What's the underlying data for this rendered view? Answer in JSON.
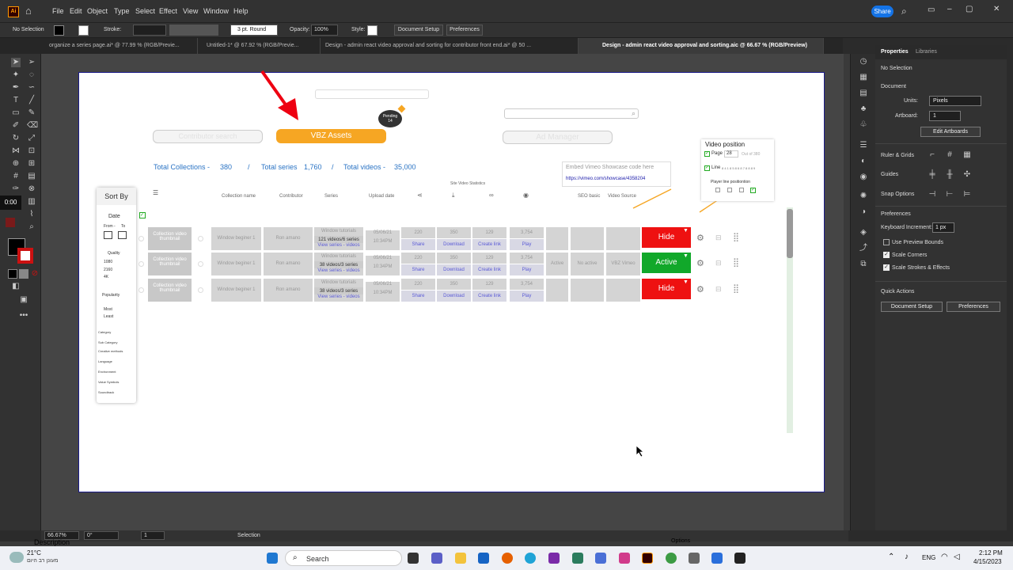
{
  "menubar": {
    "logo": "Ai",
    "items": [
      "File",
      "Edit",
      "Object",
      "Type",
      "Select",
      "Effect",
      "View",
      "Window",
      "Help"
    ],
    "share": "Share"
  },
  "control": {
    "selection": "No Selection",
    "stroke": "Stroke:",
    "brush": "3 pt. Round",
    "opacity_label": "Opacity:",
    "opacity": "100%",
    "style": "Style:",
    "doc_setup": "Document Setup",
    "preferences": "Preferences"
  },
  "tabs": [
    "organize a series page.ai* @ 77.99 % (RGB/Previe...",
    "Untitled-1* @ 67.92 % (RGB/Previe...",
    "Design - admin react video approval and sorting for contributor front end.ai* @ 50 ...",
    "Design - admin react video approval and sorting.aic @ 66.67 % (RGB/Preview)"
  ],
  "timer": "0:00",
  "design": {
    "top_buttons": [
      "Contributor search",
      "VBZ Assets",
      "Ad Manager"
    ],
    "pending_label": "Pending",
    "pending_count": "14",
    "totals": {
      "collections_label": "Total Collections -",
      "collections": "380",
      "series_label": "Total series",
      "series": "1,760",
      "videos_label": "Total videos -",
      "videos": "35,000",
      "sep": "/"
    },
    "embed": {
      "title": "Embed Vimeo Showcase code here",
      "url": "https://vimeo.com/showcase/4358204"
    },
    "video_position": {
      "title": "Video position",
      "page_label": "Page",
      "page": "28",
      "out_of": "Out of 380",
      "line_label": "Line",
      "lines": "8 4 1 8 5 8 6 8 7 8 8 8 9",
      "player": "Player line positiontion"
    },
    "sort": {
      "title": "Sort By",
      "date": "Date",
      "from": "From -",
      "to": "To",
      "quality": "Quality",
      "q": [
        "1080",
        "2160",
        "4K"
      ],
      "popularity": "Popularity",
      "most": "Most",
      "least": "Least",
      "filters": [
        "Category",
        "Sub Category",
        "Creative methods",
        "Language",
        "Environment",
        "Value Symbols",
        "Soundtrack"
      ]
    },
    "headers": {
      "collection": "Collection name",
      "contributor": "Contributor",
      "series": "Series",
      "upload": "Upload date",
      "stats": "Site Video Statistics",
      "seo": "SEO basic",
      "source": "Video Source"
    },
    "rows": [
      {
        "thumb": "Collection video thumbnail",
        "name": "Window beginer 1",
        "contributor": "Ron amano",
        "series_title": "Window tutorials",
        "series_count": "121 videos/6 series",
        "series_link": "View series - videos",
        "date": "05/06/21",
        "time": "10:34PM",
        "n1": "220",
        "n2": "350",
        "n3": "129",
        "n4": "3,754",
        "share": "Share",
        "download": "Download",
        "link": "Create link",
        "play": "Play",
        "seo1": "",
        "seo2": "",
        "source": "",
        "status": "Hide",
        "color": "#ee1111"
      },
      {
        "thumb": "Collection video thumbnail",
        "name": "Window beginer 1",
        "contributor": "Ron amano",
        "series_title": "Window tutorials",
        "series_count": "38 videos/3 series",
        "series_link": "View series - videos",
        "date": "05/06/21",
        "time": "10:34PM",
        "n1": "220",
        "n2": "350",
        "n3": "129",
        "n4": "3,754",
        "share": "Share",
        "download": "Download",
        "link": "Create link",
        "play": "Play",
        "seo1": "Active",
        "seo2": "No active",
        "source": "VBZ Vimeo",
        "status": "Active",
        "color": "#11a82a"
      },
      {
        "thumb": "Collection video thumbnail",
        "name": "Window beginer 1",
        "contributor": "Ron amano",
        "series_title": "Window tutorials",
        "series_count": "38 videos/3 series",
        "series_link": "View series - videos",
        "date": "05/06/21",
        "time": "10:34PM",
        "n1": "220",
        "n2": "350",
        "n3": "129",
        "n4": "3,754",
        "share": "Share",
        "download": "Download",
        "link": "Create link",
        "play": "Play",
        "seo1": "",
        "seo2": "",
        "source": "",
        "status": "Hide",
        "color": "#ee1111"
      }
    ]
  },
  "properties": {
    "tabs": [
      "Properties",
      "Libraries"
    ],
    "no_selection": "No Selection",
    "document": "Document",
    "units_label": "Units:",
    "units": "Pixels",
    "artboard_label": "Artboard:",
    "artboard": "1",
    "edit_artboards": "Edit Artboards",
    "ruler": "Ruler & Grids",
    "guides": "Guides",
    "snap": "Snap Options",
    "prefs": "Preferences",
    "kbd_label": "Keyboard Increment:",
    "kbd": "1 px",
    "c1": "Use Preview Bounds",
    "c2": "Scale Corners",
    "c3": "Scale Strokes & Effects",
    "quick": "Quick Actions",
    "doc_setup": "Document Setup",
    "preferences": "Preferences"
  },
  "status": {
    "zoom": "66.67%",
    "rotate": "0°",
    "artboard": "1",
    "tool": "Selection"
  },
  "taskbar": {
    "temp": "21°C",
    "weather": "מעונן רב היום",
    "search": "Search",
    "lang": "ENG",
    "time": "2:12 PM",
    "date": "4/15/2023",
    "desc": "Description",
    "options": "Options"
  }
}
